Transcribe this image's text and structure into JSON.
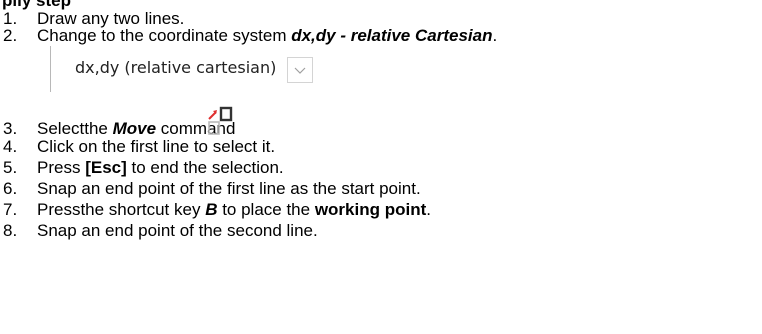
{
  "heading": "pily step",
  "dropdown": {
    "value": "dx,dy (relative cartesian)"
  },
  "steps": [
    {
      "num": "1.",
      "text": "Draw any two lines."
    },
    {
      "num": "2.",
      "pre": "Change to the coordinate system ",
      "em": "dx,dy - relative Cartesian",
      "post": "."
    },
    {
      "num": "3.",
      "pre": "Selectthe ",
      "em": "Move",
      "post": " command"
    },
    {
      "num": "4.",
      "text": "Click on the first line to select it."
    },
    {
      "num": "5.",
      "pre": "Press ",
      "em": "[Esc]",
      "post": " to end the selection."
    },
    {
      "num": "6.",
      "text": "Snap an end point of the first line as the start point."
    },
    {
      "num": "7.",
      "pre": "Pressthe shortcut key ",
      "em": "B",
      "mid": " to place the ",
      "em2": "working point",
      "post": "."
    },
    {
      "num": "8.",
      "text": "Snap an end point of the second line."
    }
  ],
  "icons": {
    "dropdown_arrow": "chevron-down-icon",
    "move_command": "move-command-icon"
  },
  "colors": {
    "text": "#000000",
    "icon_red": "#e03030",
    "icon_dark": "#333333"
  }
}
